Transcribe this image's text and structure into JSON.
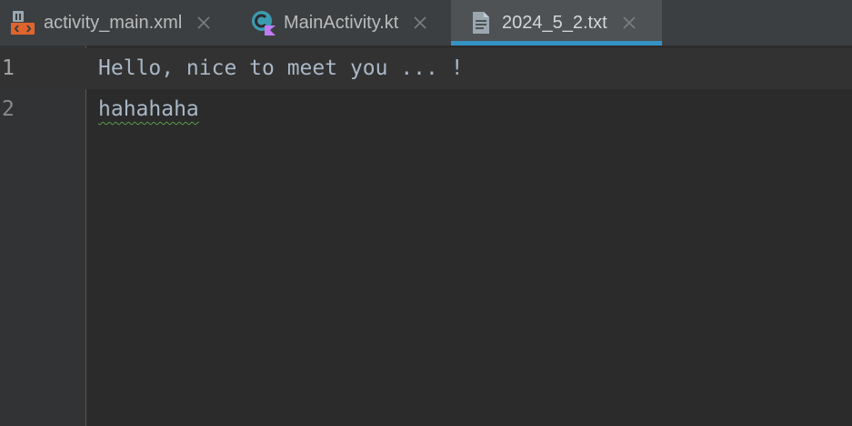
{
  "tabs": [
    {
      "label": "activity_main.xml",
      "icon": "xml-layout-file-icon",
      "active": false
    },
    {
      "label": "MainActivity.kt",
      "icon": "kotlin-class-file-icon",
      "active": false
    },
    {
      "label": "2024_5_2.txt",
      "icon": "text-file-icon",
      "active": true
    }
  ],
  "editor": {
    "lines": [
      {
        "number": "1",
        "text": "Hello, nice to meet you ... !"
      },
      {
        "number": "2",
        "text": "hahahaha"
      }
    ]
  },
  "colors": {
    "background": "#2b2b2b",
    "tab_bar": "#3c3f41",
    "active_tab": "#4e5254",
    "active_tab_indicator": "#3592c4",
    "code_text": "#a9b7c6",
    "typo_underline": "#5a9a4b"
  }
}
